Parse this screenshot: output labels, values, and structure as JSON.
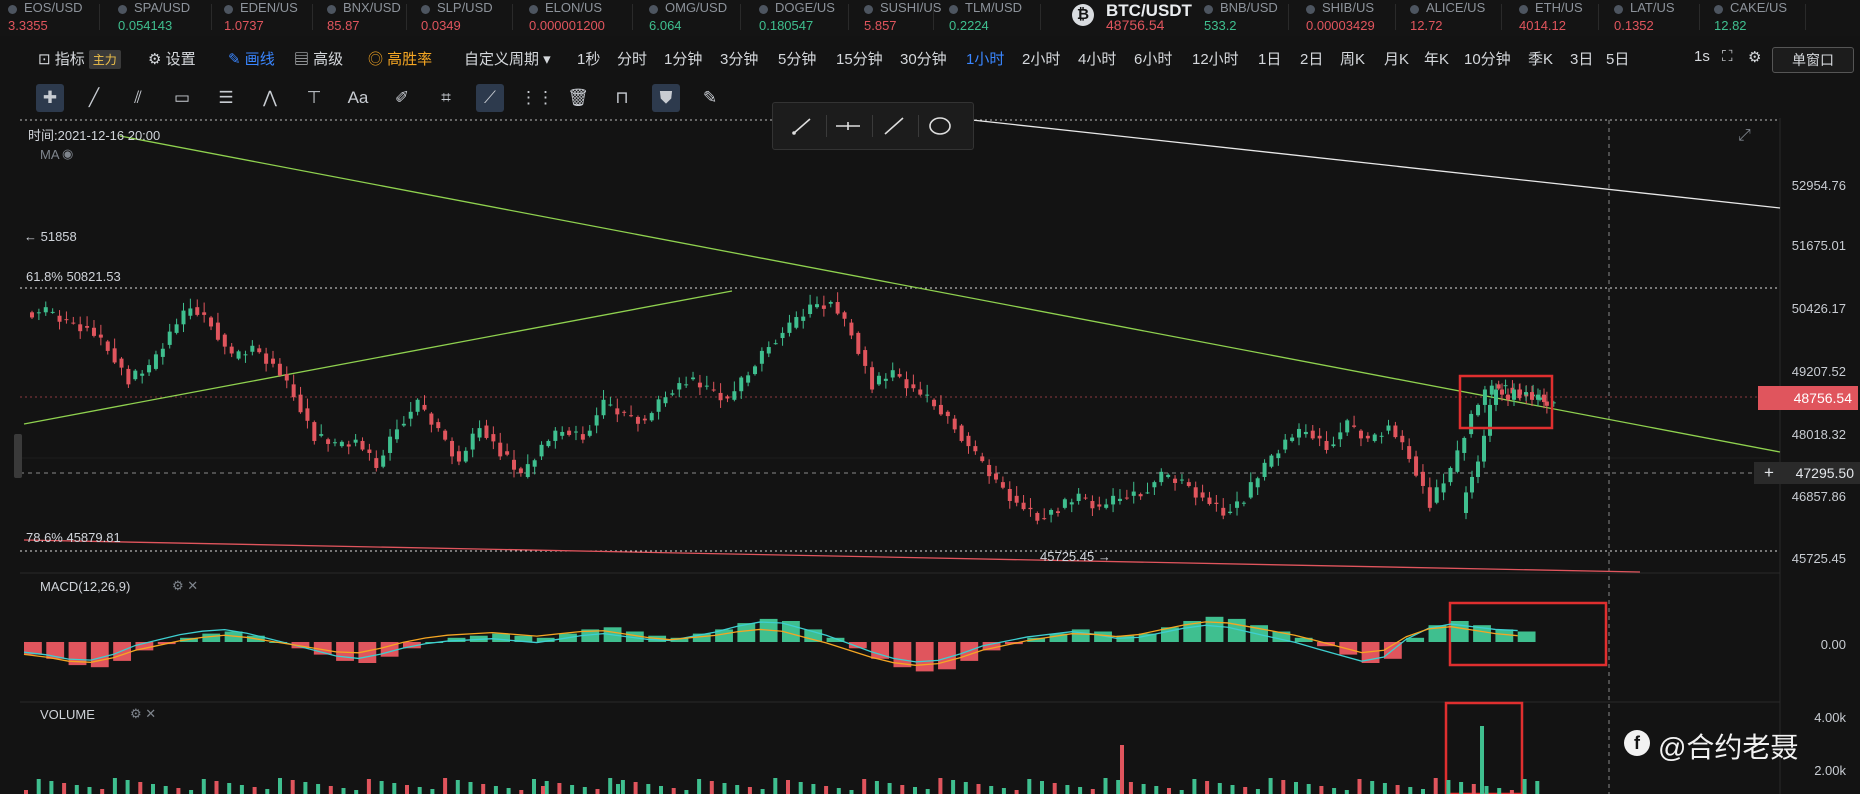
{
  "ticker": [
    {
      "symbol": "EOS/USD",
      "price": "3.3355",
      "dir": "dn"
    },
    {
      "symbol": "SPA/USD",
      "price": "0.054143",
      "dir": "up"
    },
    {
      "symbol": "EDEN/US",
      "price": "1.0737",
      "dir": "dn"
    },
    {
      "symbol": "BNX/USD",
      "price": "85.87",
      "dir": "dn"
    },
    {
      "symbol": "SLP/USD",
      "price": "0.0349",
      "dir": "dn"
    },
    {
      "symbol": "ELON/US",
      "price": "0.000001200",
      "dir": "dn"
    },
    {
      "symbol": "OMG/USD",
      "price": "6.064",
      "dir": "up"
    },
    {
      "symbol": "DOGE/US",
      "price": "0.180547",
      "dir": "up"
    },
    {
      "symbol": "SUSHI/US",
      "price": "5.857",
      "dir": "dn"
    },
    {
      "symbol": "TLM/USD",
      "price": "0.2224",
      "dir": "up"
    },
    {
      "symbol": "BNB/USD",
      "price": "533.2",
      "dir": "up"
    },
    {
      "symbol": "SHIB/US",
      "price": "0.00003429",
      "dir": "dn"
    },
    {
      "symbol": "ALICE/US",
      "price": "12.72",
      "dir": "dn"
    },
    {
      "symbol": "ETH/US",
      "price": "4014.12",
      "dir": "dn"
    },
    {
      "symbol": "LAT/US",
      "price": "0.1352",
      "dir": "dn"
    },
    {
      "symbol": "CAKE/US",
      "price": "12.82",
      "dir": "up"
    }
  ],
  "main_pair": {
    "symbol": "BTC/USDT",
    "price": "48756.54",
    "icon": "bitcoin-icon"
  },
  "toolbar": {
    "indicator": "指标",
    "main_badge": "主力",
    "settings": "设置",
    "draw": "画线",
    "advanced": "高级",
    "win_rate": "高胜率",
    "custom_period": "自定义周期",
    "periods": [
      "1秒",
      "分时",
      "1分钟",
      "3分钟",
      "5分钟",
      "15分钟",
      "30分钟",
      "1小时",
      "2小时",
      "4小时",
      "6小时",
      "12小时",
      "1日",
      "2日",
      "周K",
      "月K",
      "年K",
      "10分钟",
      "季K",
      "3日",
      "5日"
    ],
    "active_period": "1小时",
    "interval": "1s",
    "window": "单窗口"
  },
  "drawing_tools": [
    "crosshair-icon",
    "line-icon",
    "parallel-channel-icon",
    "rectangle-icon",
    "fib-icon",
    "pattern-icon",
    "measure-icon",
    "text-icon",
    "brush-icon",
    "ruler-icon",
    "projection-icon",
    "candle-style-icon",
    "delete-icon",
    "magnet-icon",
    "bookmark-icon",
    "note-icon"
  ],
  "popup_tools": [
    "ray-icon",
    "horizontal-line-icon",
    "trend-line-icon",
    "ellipse-icon"
  ],
  "chart_info": {
    "time": "时间:2021-12-16 20:00",
    "ma": "MA",
    "high_marker": "← 51858",
    "fib_618": "61.8% 50821.53",
    "fib_786": "78.6% 45879.81",
    "low_marker": "45725.45 →",
    "macd": "MACD(12,26,9)",
    "volume": "VOLUME"
  },
  "y_axis": [
    "52954.76",
    "51675.01",
    "50426.17",
    "49207.52",
    "48018.32",
    "46857.86",
    "45725.45"
  ],
  "current_price": "48756.54",
  "crosshair_price": "47295.50",
  "macd_axis": "0.00",
  "volume_axis": [
    "4.00k",
    "2.00k"
  ],
  "colors": {
    "up": "#3fbf8f",
    "down": "#e0555d",
    "accent": "#3a86ff",
    "trendline": "#8fd14f",
    "highlight": "#e02f2f"
  },
  "watermark": "@合约老聂",
  "chart_data": {
    "type": "candlestick",
    "symbol": "BTC/USDT",
    "interval": "1小时",
    "ylim": [
      45725.45,
      52954.76
    ],
    "current": 48756.54,
    "fib_levels": [
      {
        "label": "61.8%",
        "value": 50821.53
      },
      {
        "label": "78.6%",
        "value": 45879.81
      }
    ],
    "high": 51858,
    "low": 45725.45,
    "close_path": [
      50500,
      50300,
      50200,
      49800,
      49200,
      49400,
      50100,
      50600,
      50300,
      49600,
      49800,
      49500,
      48900,
      48100,
      47900,
      48000,
      47500,
      48300,
      48700,
      48200,
      47600,
      48300,
      47800,
      47300,
      47900,
      48200,
      48100,
      48700,
      48500,
      48400,
      48900,
      49200,
      49000,
      48800,
      49300,
      49900,
      50200,
      50600,
      50700,
      50100,
      49100,
      49300,
      49000,
      48700,
      48300,
      47700,
      47200,
      46800,
      46500,
      46700,
      46900,
      46700,
      46900,
      47000,
      47300,
      47200,
      46900,
      46600,
      46900,
      47500,
      48000,
      48200,
      47900,
      48300,
      48000,
      48300,
      47700,
      46800,
      47400,
      48500,
      49100,
      49000,
      48800,
      48700
    ],
    "macd_hist": [
      -30,
      -40,
      -55,
      -60,
      -45,
      -20,
      -5,
      10,
      20,
      25,
      15,
      0,
      -15,
      -30,
      -45,
      -50,
      -35,
      -15,
      0,
      10,
      15,
      20,
      15,
      10,
      20,
      30,
      35,
      25,
      15,
      10,
      20,
      30,
      45,
      55,
      50,
      30,
      10,
      -15,
      -40,
      -60,
      -70,
      -65,
      -45,
      -20,
      -5,
      10,
      20,
      30,
      25,
      15,
      20,
      35,
      50,
      60,
      55,
      40,
      25,
      10,
      -10,
      -30,
      -50,
      -40,
      10,
      40,
      50,
      40,
      30,
      25
    ],
    "volume_spikes": [
      {
        "index": 47,
        "value": 3500
      },
      {
        "index": 70,
        "value": 4000
      }
    ]
  }
}
